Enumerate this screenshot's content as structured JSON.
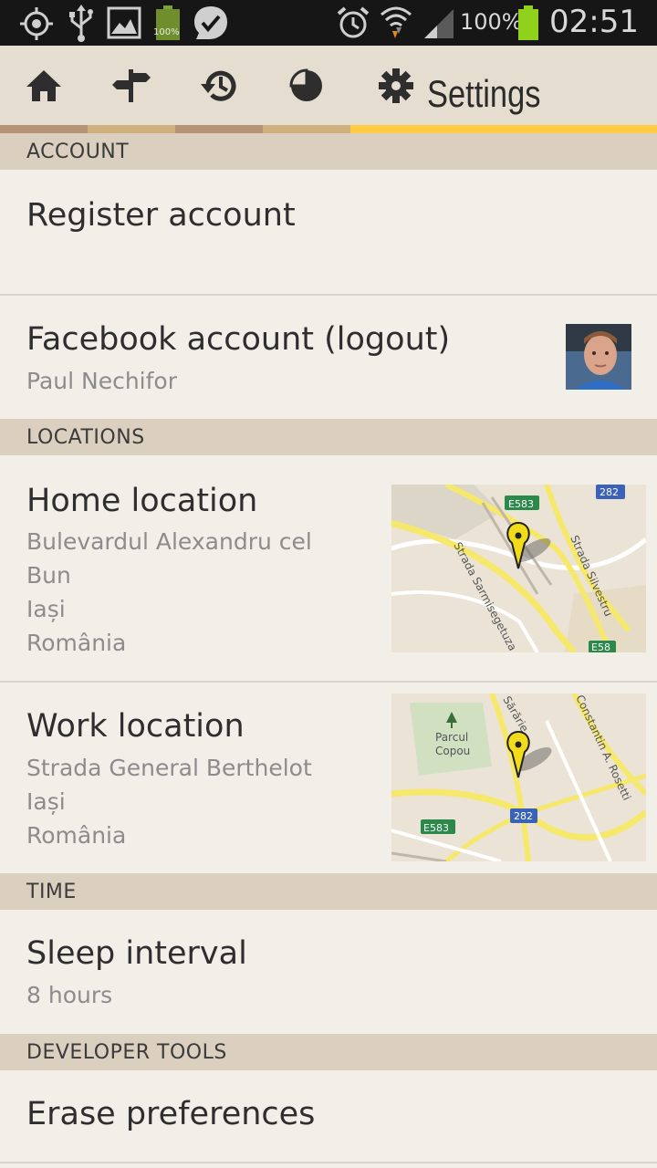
{
  "status_bar": {
    "battery_small_label": "100%",
    "battery_percent": "100%",
    "time": "02:51",
    "icons": [
      "gps-icon",
      "usb-icon",
      "gallery-icon",
      "battery-small-icon",
      "check-bubble-icon",
      "alarm-icon",
      "wifi-icon",
      "signal-icon",
      "battery-icon"
    ]
  },
  "action_bar": {
    "tabs": [
      "home-icon",
      "signpost-icon",
      "history-icon",
      "pie-chart-icon",
      "gear-icon"
    ],
    "title": "Settings"
  },
  "sections": {
    "account": "ACCOUNT",
    "locations": "LOCATIONS",
    "time": "TIME",
    "developer": "DEVELOPER TOOLS"
  },
  "items": {
    "register": {
      "title": "Register account"
    },
    "facebook": {
      "title": "Facebook account (logout)",
      "subtitle": "Paul Nechifor"
    },
    "home": {
      "title": "Home location",
      "lines": [
        "Bulevardul Alexandru cel",
        "Bun",
        "Iași",
        "România"
      ]
    },
    "work": {
      "title": "Work location",
      "lines": [
        "Strada General Berthelot",
        "Iași",
        "România"
      ]
    },
    "sleep": {
      "title": "Sleep interval",
      "subtitle": "8 hours"
    },
    "erase": {
      "title": "Erase preferences"
    }
  },
  "maps": {
    "home": {
      "labels": [
        "E583",
        "282",
        "Strada Sarmisegetuza",
        "Strada Silvestru",
        "E58"
      ]
    },
    "work": {
      "labels": [
        "Parcul",
        "Copou",
        "Sărărie",
        "Constantin A. Rosetti",
        "282",
        "E583"
      ]
    }
  },
  "colors": {
    "accent": "#ffcc44",
    "tab_strip_1": "#b69276",
    "tab_strip_2": "#cfb07e",
    "section_bg": "#dbd0bf",
    "background": "#f2efe9"
  }
}
